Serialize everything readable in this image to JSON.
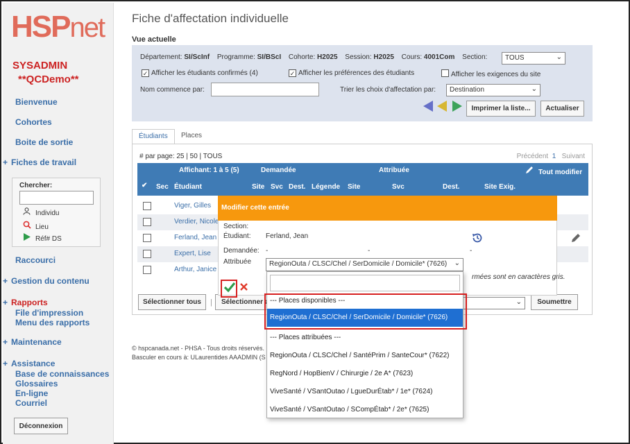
{
  "brand": {
    "logo_main": "HSP",
    "logo_sub": "net"
  },
  "user": {
    "role": "SYSADMIN",
    "program": "**QCDemo**"
  },
  "sidebar": {
    "items": [
      {
        "label": "Bienvenue"
      },
      {
        "label": "Cohortes"
      },
      {
        "label": "Boite de sortie"
      },
      {
        "label": "Fiches de travail"
      }
    ],
    "search": {
      "label": "Chercher:",
      "options": [
        "Individu",
        "Lieu",
        "Réf# DS"
      ]
    },
    "raccourci": "Raccourci",
    "gestion": "Gestion du contenu",
    "rapports": "Rapports",
    "rapports_sub": [
      "File d'impression",
      "Menu des rapports"
    ],
    "maintenance": "Maintenance",
    "assistance": "Assistance",
    "assistance_sub": [
      "Base de connaissances",
      "Glossaires",
      "En-ligne",
      "Courriel"
    ],
    "logout": "Déconnexion"
  },
  "page": {
    "title": "Fiche d'affectation individuelle",
    "vue_label": "Vue actuelle"
  },
  "filters": {
    "dept_label": "Département:",
    "dept": "SI/ScInf",
    "prog_label": "Programme:",
    "prog": "SI/BScI",
    "cohort_label": "Cohorte:",
    "cohort": "H2025",
    "session_label": "Session:",
    "session": "H2025",
    "course_label": "Cours:",
    "course": "4001Com",
    "section_label": "Section:",
    "section": "TOUS",
    "chk_confirmed": "Afficher les étudiants confirmés (4)",
    "chk_prefs": "Afficher les préférences des étudiants",
    "chk_site": "Afficher les exigences du site",
    "name_label": "Nom commence par:",
    "sort_label": "Trier les choix d'affectation par:",
    "sort_value": "Destination",
    "print_btn": "Imprimer la liste...",
    "refresh_btn": "Actualiser"
  },
  "tabs": [
    {
      "label": "Étudiants"
    },
    {
      "label": "Places"
    }
  ],
  "table": {
    "perpage": "# par page: 25 | 50 | TOUS",
    "prev": "Précédent",
    "page": "1",
    "next": "Suivant",
    "showing": "Affichant: 1 à 5 (5)",
    "grp_requested": "Demandée",
    "grp_assigned": "Attribuée",
    "edit_all": "Tout modifier",
    "cols": [
      "Sec",
      "Étudiant",
      "Site",
      "Svc",
      "Dest.",
      "Légende",
      "Site",
      "Svc",
      "Dest.",
      "Site Exig."
    ],
    "rows": [
      {
        "name": "Viger, Gilles"
      },
      {
        "name": "Verdier, Nicole"
      },
      {
        "name": "Ferland, Jean"
      },
      {
        "name": "Expert, Lise"
      },
      {
        "name": "Arthur, Janice"
      }
    ],
    "select_all": "Sélectionner tous",
    "select_btn": "Sélectionner a",
    "submit": "Soumettre"
  },
  "modal": {
    "title": "Modifier cette entrée",
    "section_label": "Section:",
    "student_label": "Étudiant:",
    "student": "Ferland, Jean",
    "requested_label": "Demandée:",
    "requested_dash": "-",
    "assigned_label": "Attribuée",
    "assigned_value": "RegionOuta / CLSC/Chel / SerDomicile / Domicile* (7626)",
    "note": "rmées sont en caractères gris."
  },
  "dropdown": {
    "group_available": "--- Places disponibles ---",
    "selected": "RegionOuta / CLSC/Chel / SerDomicile / Domicile* (7626)",
    "group_assigned": "--- Places attribuées ---",
    "options": [
      "RegionOuta / CLSC/Chel / SantéPrim / SanteCour* (7622)",
      "RegNord / HopBienV / Chirurgie / 2e A* (7623)",
      "ViveSanté / VSantOutao / LgueDurÉtab* / 1e* (7624)",
      "ViveSanté / VSantOutao / SCompÉtab* / 2e* (7625)"
    ]
  },
  "footer": {
    "line1": "© hspcanada.net - PHSA - Tous droits réservés.",
    "line2": "Basculer en cours à: ULaurentides AAADMIN (S"
  },
  "colors": {
    "header_blue": "#3f7bb5",
    "modal_orange": "#f7980d",
    "selected_blue": "#1f6fd2",
    "highlight_red": "#d61f1f"
  }
}
